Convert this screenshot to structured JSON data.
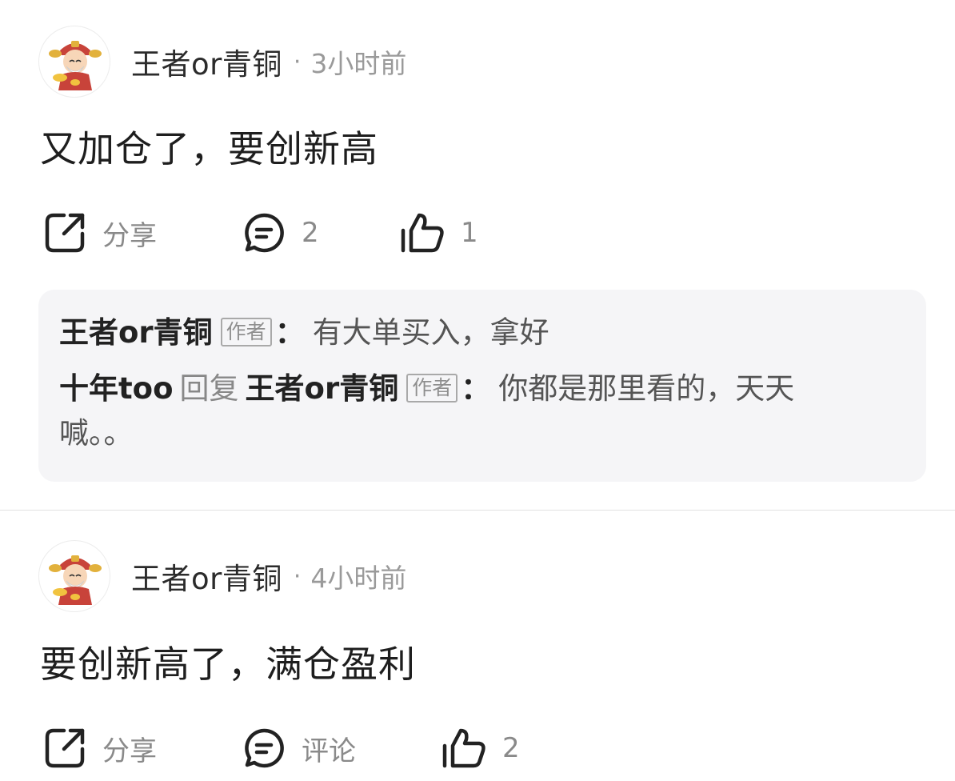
{
  "posts": [
    {
      "username": "王者or青铜",
      "separator": "·",
      "time": "3小时前",
      "text": "又加仓了，要创新高",
      "actions": {
        "share_label": "分享",
        "comment_label": "2",
        "like_label": "1"
      },
      "replies": [
        {
          "author": "王者or青铜",
          "badge": "作者",
          "colon": "：",
          "text": "有大单买入，拿好"
        },
        {
          "author": "十年too",
          "reply_word": "回复",
          "target": "王者or青铜",
          "badge": "作者",
          "colon": "：",
          "text": "你都是那里看的，天天",
          "text_cont": "喊。。"
        }
      ]
    },
    {
      "username": "王者or青铜",
      "separator": "·",
      "time": "4小时前",
      "text": "要创新高了，满仓盈利",
      "actions": {
        "share_label": "分享",
        "comment_label": "评论",
        "like_label": "2"
      }
    }
  ],
  "icons": {
    "share": "share-icon",
    "comment": "comment-icon",
    "like": "thumbs-up-icon",
    "avatar": "fortune-god-avatar"
  },
  "colors": {
    "text_primary": "#1e1e1e",
    "text_secondary": "#8a8a8a",
    "reply_background": "#f5f5f7",
    "divider": "#e2e2e2"
  }
}
